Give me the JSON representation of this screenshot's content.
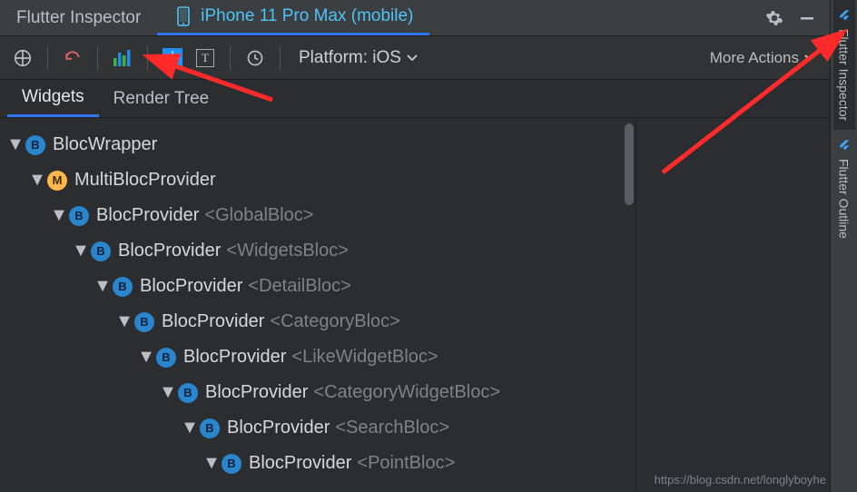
{
  "top": {
    "tabs": [
      {
        "label": "Flutter Inspector"
      },
      {
        "label": "iPhone 11 Pro Max (mobile)"
      }
    ]
  },
  "toolbar": {
    "platform_label": "Platform: iOS",
    "more_actions": "More Actions"
  },
  "sub_tabs": {
    "widgets": "Widgets",
    "render_tree": "Render Tree"
  },
  "rail": {
    "inspector": "Flutter Inspector",
    "outline": "Flutter Outline"
  },
  "tree": [
    {
      "indent": 0,
      "badge": "B",
      "name": "BlocWrapper",
      "sub": ""
    },
    {
      "indent": 1,
      "badge": "M",
      "name": "MultiBlocProvider",
      "sub": ""
    },
    {
      "indent": 2,
      "badge": "B",
      "name": "BlocProvider",
      "sub": "<GlobalBloc>"
    },
    {
      "indent": 3,
      "badge": "B",
      "name": "BlocProvider",
      "sub": "<WidgetsBloc>"
    },
    {
      "indent": 4,
      "badge": "B",
      "name": "BlocProvider",
      "sub": "<DetailBloc>"
    },
    {
      "indent": 5,
      "badge": "B",
      "name": "BlocProvider",
      "sub": "<CategoryBloc>"
    },
    {
      "indent": 6,
      "badge": "B",
      "name": "BlocProvider",
      "sub": "<LikeWidgetBloc>"
    },
    {
      "indent": 7,
      "badge": "B",
      "name": "BlocProvider",
      "sub": "<CategoryWidgetBloc>"
    },
    {
      "indent": 8,
      "badge": "B",
      "name": "BlocProvider",
      "sub": "<SearchBloc>"
    },
    {
      "indent": 9,
      "badge": "B",
      "name": "BlocProvider",
      "sub": "<PointBloc>"
    }
  ],
  "watermark": "https://blog.csdn.net/longlyboyhe"
}
